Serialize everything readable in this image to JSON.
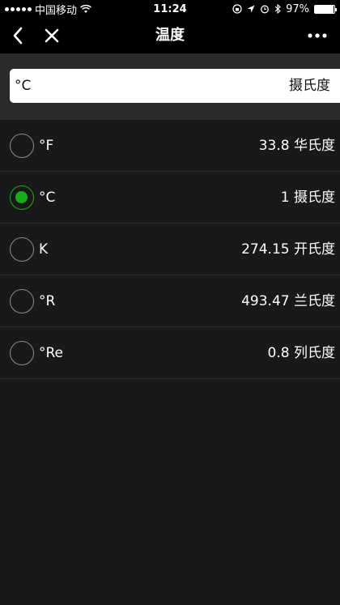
{
  "status_bar": {
    "carrier": "中国移动",
    "time": "11:24",
    "battery": "97%",
    "battery_level": 0.97
  },
  "nav": {
    "title": "温度",
    "icons": [
      "back-chevron-icon",
      "close-icon",
      "more-icon"
    ]
  },
  "input": {
    "unit": "°C",
    "unit_name": "摄氏度"
  },
  "accent_color": "#1aad19",
  "units": [
    {
      "symbol": "°F",
      "value": "33.8",
      "name": "华氏度",
      "selected": false
    },
    {
      "symbol": "°C",
      "value": "1",
      "name": "摄氏度",
      "selected": true
    },
    {
      "symbol": "K",
      "value": "274.15",
      "name": "开氏度",
      "selected": false
    },
    {
      "symbol": "°R",
      "value": "493.47",
      "name": "兰氏度",
      "selected": false
    },
    {
      "symbol": "°Re",
      "value": "0.8",
      "name": "列氏度",
      "selected": false
    }
  ]
}
